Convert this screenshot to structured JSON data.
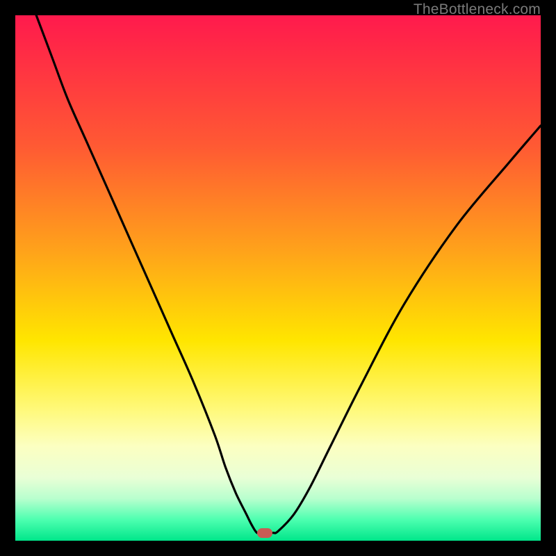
{
  "watermark": "TheBottleneck.com",
  "colors": {
    "frame": "#000000",
    "gradient_top": "#ff1a4d",
    "gradient_mid": "#ffe600",
    "gradient_bottom": "#00e68a",
    "curve": "#000000",
    "marker": "#c95c55"
  },
  "chart_data": {
    "type": "line",
    "title": "",
    "xlabel": "",
    "ylabel": "",
    "xlim": [
      0,
      100
    ],
    "ylim": [
      0,
      100
    ],
    "grid": false,
    "series": [
      {
        "name": "curve",
        "x": [
          4,
          7,
          10,
          14,
          18,
          22,
          26,
          30,
          34,
          38,
          40,
          42,
          44,
          45,
          46,
          47,
          49,
          50,
          53,
          56,
          60,
          66,
          74,
          84,
          94,
          100
        ],
        "y": [
          100,
          92,
          84,
          75,
          66,
          57,
          48,
          39,
          30,
          20,
          14,
          9,
          5,
          3,
          1.5,
          1.5,
          1.5,
          1.8,
          5,
          10,
          18,
          30,
          45,
          60,
          72,
          79
        ]
      }
    ],
    "marker": {
      "x": 47.5,
      "y": 1.5
    },
    "legend": false
  }
}
